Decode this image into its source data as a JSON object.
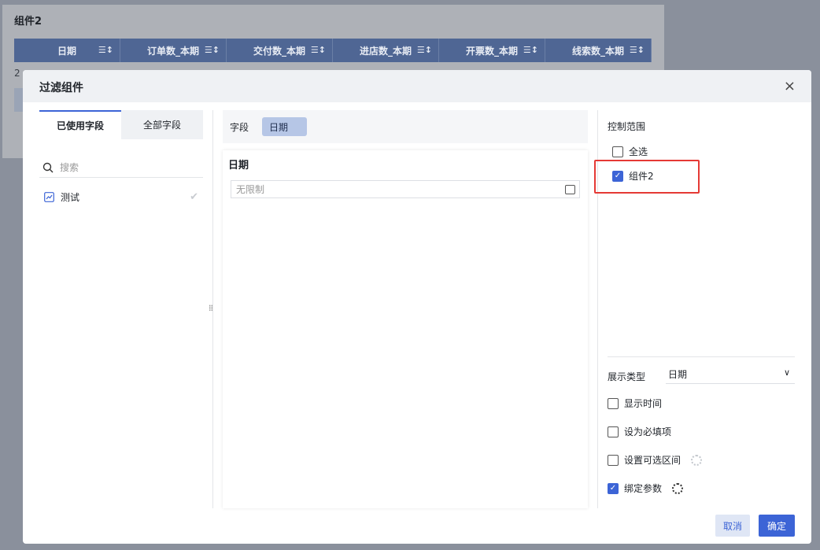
{
  "background": {
    "title": "组件2",
    "columns": [
      "日期",
      "订单数_本期",
      "交付数_本期",
      "进店数_本期",
      "开票数_本期",
      "线索数_本期"
    ],
    "row_partial": "2",
    "colors": {
      "header_bg": "#4f6694"
    }
  },
  "dialog": {
    "title": "过滤组件",
    "close": "×",
    "tabs": [
      {
        "label": "已使用字段",
        "active": true
      },
      {
        "label": "全部字段",
        "active": false
      }
    ],
    "search_placeholder": "搜索",
    "fields": [
      {
        "label": "测试",
        "checked": true
      }
    ],
    "field_bar": {
      "label": "字段",
      "tag": "日期"
    },
    "panel": {
      "title": "日期",
      "input_placeholder": "无限制"
    },
    "control_range": {
      "title": "控制范围",
      "select_all": "全选",
      "select_all_checked": false,
      "items": [
        {
          "label": "组件2",
          "checked": true
        }
      ]
    },
    "display_type": {
      "label": "展示类型",
      "value": "日期"
    },
    "options": [
      {
        "label": "显示时间",
        "checked": false
      },
      {
        "label": "设为必填项",
        "checked": false
      },
      {
        "label": "设置可选区间",
        "checked": false,
        "gear": true
      },
      {
        "label": "绑定参数",
        "checked": true,
        "gear": true
      }
    ],
    "buttons": {
      "cancel": "取消",
      "ok": "确定"
    },
    "colors": {
      "accent": "#3c64d6",
      "highlight": "#e53935"
    }
  }
}
